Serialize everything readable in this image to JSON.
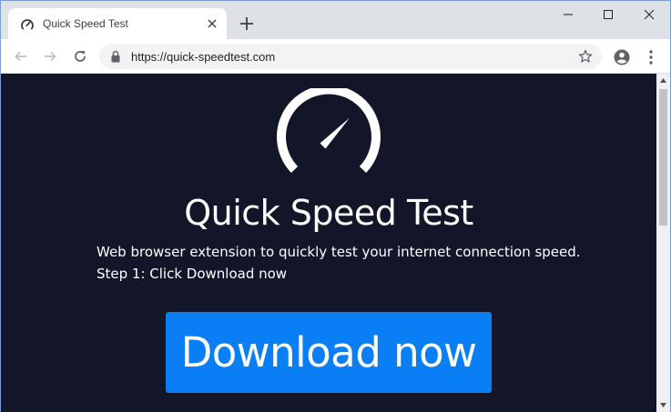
{
  "browser": {
    "tab": {
      "title": "Quick Speed Test",
      "favicon": "speedometer-icon"
    },
    "new_tab_icon": "plus-icon",
    "window_controls": [
      "minimize-icon",
      "maximize-icon",
      "close-icon"
    ],
    "toolbar": {
      "back_icon": "arrow-left-icon",
      "forward_icon": "arrow-right-icon",
      "reload_icon": "reload-icon",
      "url": "https://quick-speedtest.com",
      "secure_icon": "lock-icon",
      "bookmark_icon": "star-icon",
      "account_icon": "account-icon",
      "menu_icon": "kebab-menu-icon"
    }
  },
  "page": {
    "logo_icon": "speedometer-icon",
    "heading": "Quick Speed Test",
    "description": "Web browser extension to quickly test your internet connection speed.",
    "step": "Step 1: Click Download now",
    "download_button": "Download now"
  },
  "colors": {
    "page_background": "#131628",
    "button": "#0a7ef4",
    "text": "#ffffff",
    "tab_strip": "#dee1e6"
  }
}
